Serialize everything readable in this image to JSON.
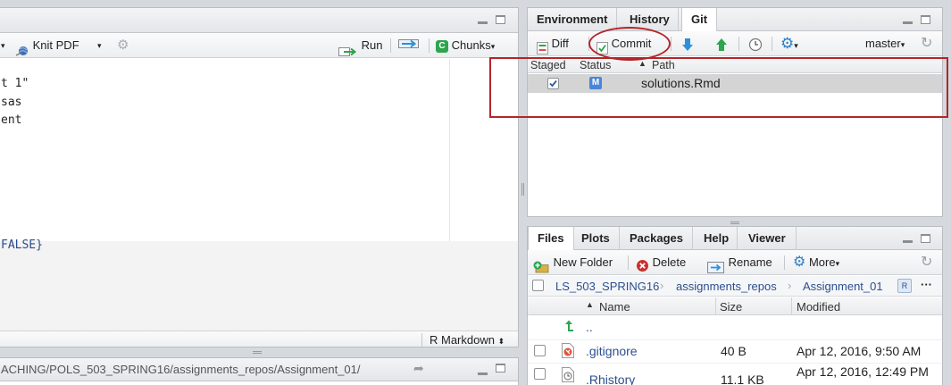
{
  "editor": {
    "knit_label": "Knit PDF",
    "run_label": "Run",
    "chunks_label": "Chunks",
    "code_lines": [
      "t 1\"",
      "sas",
      "ent"
    ],
    "chunk_line": "FALSE}",
    "mode_label": "R Markdown"
  },
  "console": {
    "path": "ACHING/POLS_503_SPRING16/assignments_repos/Assignment_01/"
  },
  "git_pane": {
    "tabs": [
      "Environment",
      "History",
      "Git"
    ],
    "diff_label": "Diff",
    "commit_label": "Commit",
    "branch": "master",
    "columns": {
      "staged": "Staged",
      "status": "Status",
      "path": "Path"
    },
    "rows": [
      {
        "staged": true,
        "status": "M",
        "path": "solutions.Rmd"
      }
    ]
  },
  "files_pane": {
    "tabs": [
      "Files",
      "Plots",
      "Packages",
      "Help",
      "Viewer"
    ],
    "new_folder_label": "New Folder",
    "delete_label": "Delete",
    "rename_label": "Rename",
    "more_label": "More",
    "breadcrumb": [
      "LS_503_SPRING16",
      "assignments_repos",
      "Assignment_01"
    ],
    "columns": {
      "name": "Name",
      "size": "Size",
      "modified": "Modified"
    },
    "up_label": "..",
    "rows": [
      {
        "name": ".gitignore",
        "size": "40 B",
        "modified": "Apr 12, 2016, 9:50 AM"
      },
      {
        "name": ".Rhistory",
        "size": "11.1 KB",
        "modified": "Apr 12, 2016, 12:49 PM"
      }
    ]
  },
  "colors": {
    "annotation_red": "#b3252a",
    "git_green": "#2ea44f",
    "git_blue": "#2f8fd8"
  }
}
